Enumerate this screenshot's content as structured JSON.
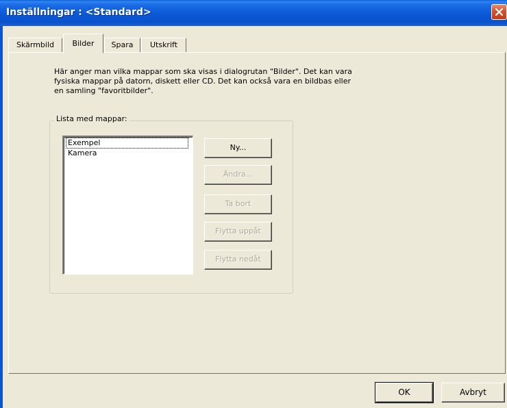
{
  "window": {
    "title": "Inställningar : <Standard>",
    "colors": {
      "titlebar": "#0a52cc",
      "close": "#d5512b",
      "face": "#ece9d8"
    }
  },
  "tabs": [
    {
      "label": "Skärmbild",
      "active": false
    },
    {
      "label": "Bilder",
      "active": true
    },
    {
      "label": "Spara",
      "active": false
    },
    {
      "label": "Utskrift",
      "active": false
    }
  ],
  "panel": {
    "description": "Här anger man vilka mappar som ska visas i dialogrutan \"Bilder\". Det kan vara\nfysiska mappar på datorn, diskett eller CD. Det kan också vara en bildbas eller\nen samling \"favoritbilder\".",
    "group_label": "Lista med mappar:",
    "list_items": [
      "Exempel",
      "Kamera"
    ],
    "focused_item": "Exempel",
    "buttons": [
      {
        "label": "Ny...",
        "enabled": true
      },
      {
        "label": "Ändra...",
        "enabled": false
      },
      {
        "label": "Ta bort",
        "enabled": false
      },
      {
        "label": "Flytta uppåt",
        "enabled": false
      },
      {
        "label": "Flytta nedåt",
        "enabled": false
      }
    ]
  },
  "footer": {
    "ok_label": "OK",
    "cancel_label": "Avbryt"
  }
}
